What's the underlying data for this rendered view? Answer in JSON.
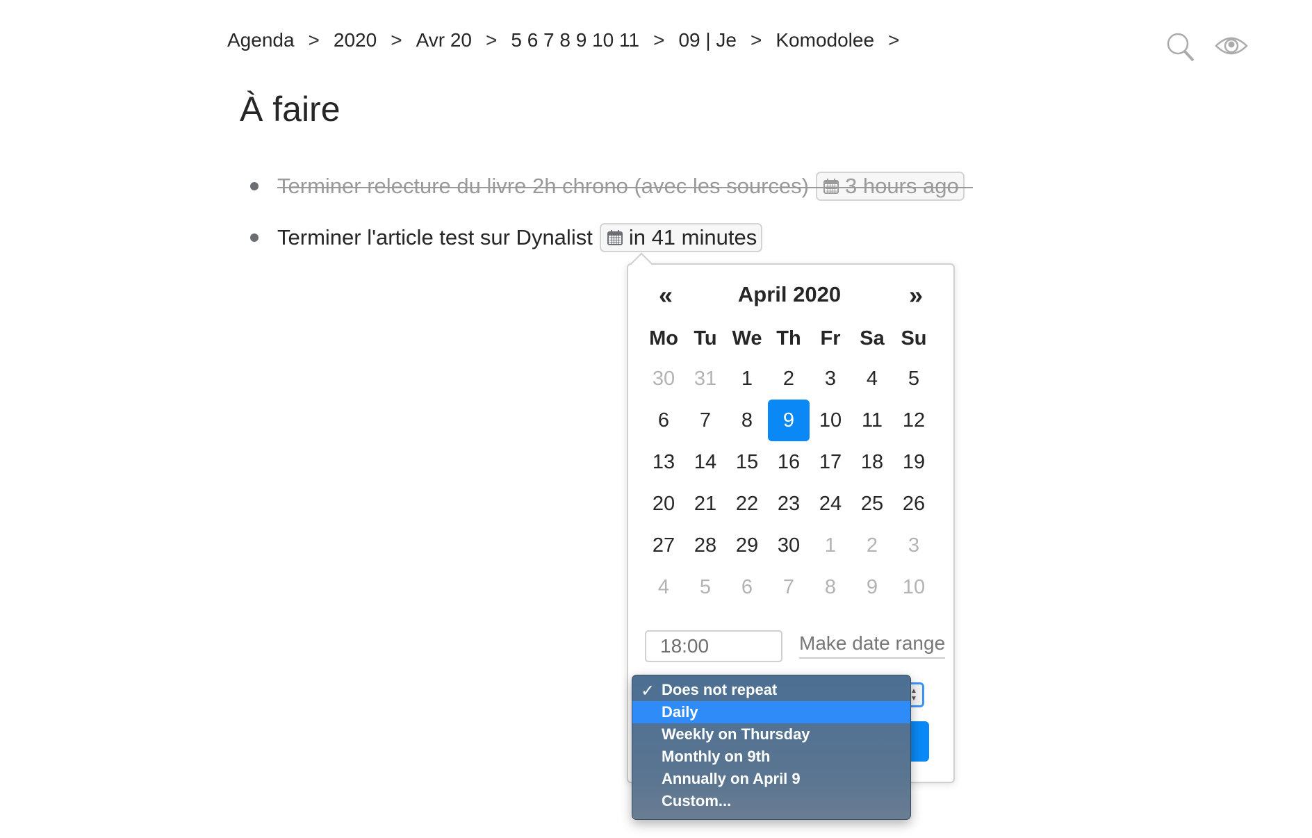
{
  "breadcrumb": {
    "items": [
      "Agenda",
      "2020",
      "Avr 20",
      "5 6 7 8 9 10 11",
      "09 | Je",
      "Komodolee"
    ],
    "separator": ">"
  },
  "toolbar": {
    "search_icon": "search-icon",
    "view_icon": "eye-icon"
  },
  "page": {
    "title": "À faire"
  },
  "items": [
    {
      "text": "Terminer relecture du livre 2h chrono (avec les sources)",
      "completed": true,
      "date_badge": "3 hours ago",
      "badge_icon": "calendar-icon"
    },
    {
      "text": "Terminer l'article test sur Dynalist",
      "completed": false,
      "date_badge": "in 41 minutes",
      "badge_icon": "calendar-icon"
    }
  ],
  "datepicker": {
    "prev_label": "«",
    "next_label": "»",
    "month_title": "April 2020",
    "weekdays": [
      "Mo",
      "Tu",
      "We",
      "Th",
      "Fr",
      "Sa",
      "Su"
    ],
    "weeks": [
      [
        {
          "d": "30",
          "m": true
        },
        {
          "d": "31",
          "m": true
        },
        {
          "d": "1"
        },
        {
          "d": "2"
        },
        {
          "d": "3"
        },
        {
          "d": "4"
        },
        {
          "d": "5"
        }
      ],
      [
        {
          "d": "6"
        },
        {
          "d": "7"
        },
        {
          "d": "8"
        },
        {
          "d": "9",
          "sel": true
        },
        {
          "d": "10"
        },
        {
          "d": "11"
        },
        {
          "d": "12"
        }
      ],
      [
        {
          "d": "13"
        },
        {
          "d": "14"
        },
        {
          "d": "15"
        },
        {
          "d": "16"
        },
        {
          "d": "17"
        },
        {
          "d": "18"
        },
        {
          "d": "19"
        }
      ],
      [
        {
          "d": "20"
        },
        {
          "d": "21"
        },
        {
          "d": "22"
        },
        {
          "d": "23"
        },
        {
          "d": "24"
        },
        {
          "d": "25"
        },
        {
          "d": "26"
        }
      ],
      [
        {
          "d": "27"
        },
        {
          "d": "28"
        },
        {
          "d": "29"
        },
        {
          "d": "30"
        },
        {
          "d": "1",
          "m": true
        },
        {
          "d": "2",
          "m": true
        },
        {
          "d": "3",
          "m": true
        }
      ],
      [
        {
          "d": "4",
          "m": true
        },
        {
          "d": "5",
          "m": true
        },
        {
          "d": "6",
          "m": true
        },
        {
          "d": "7",
          "m": true
        },
        {
          "d": "8",
          "m": true
        },
        {
          "d": "9",
          "m": true
        },
        {
          "d": "10",
          "m": true
        }
      ]
    ],
    "selected_day": "9",
    "time_value": "18:00",
    "make_range_label": "Make date range",
    "accent_color": "#0a88f5"
  },
  "repeat_dropdown": {
    "selected": "Does not repeat",
    "highlighted": "Daily",
    "options": [
      "Does not repeat",
      "Daily",
      "Weekly on Thursday",
      "Monthly on 9th",
      "Annually on April 9",
      "Custom..."
    ],
    "check_glyph": "✓"
  }
}
